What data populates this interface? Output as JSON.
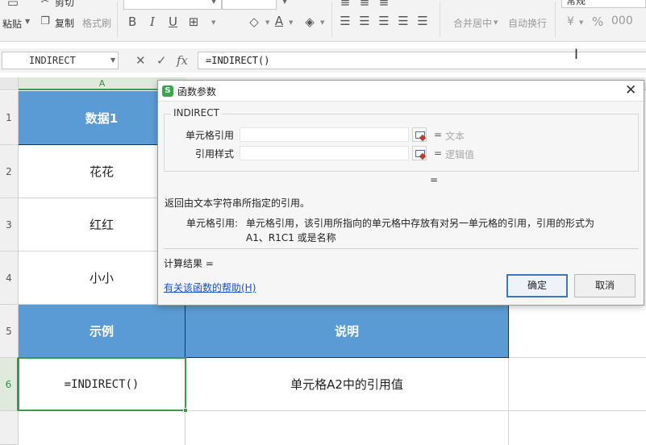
{
  "ribbon": {
    "paste_label": "粘贴",
    "cut_label": "剪切",
    "copy_label": "复制",
    "format_painter_label": "格式刷",
    "bold": "B",
    "italic": "I",
    "underline": "U",
    "merge_center_label": "合并居中",
    "wrap_text_label": "自动换行",
    "number_format_value": "常规",
    "percent_symbol": "%",
    "currency_symbol": "¥"
  },
  "formula_bar": {
    "name_box": "INDIRECT",
    "cancel_icon": "✕",
    "enter_icon": "✓",
    "fx_label": "fx",
    "formula": "=INDIRECT()"
  },
  "grid": {
    "column_headers": [
      "A"
    ],
    "row_headers": [
      "1",
      "2",
      "3",
      "4",
      "5",
      "6"
    ],
    "rows": [
      [
        "数据1"
      ],
      [
        "花花"
      ],
      [
        "红红"
      ],
      [
        "小小"
      ],
      [
        "示例",
        "说明"
      ],
      [
        "=INDIRECT()",
        "单元格A2中的引用值"
      ]
    ],
    "active_cell": "A6"
  },
  "dialog": {
    "title": "函数参数",
    "close_icon": "✕",
    "logo_letter": "S",
    "function_name": "INDIRECT",
    "args": [
      {
        "label": "单元格引用",
        "value": "",
        "equals": "=",
        "hint": "文本"
      },
      {
        "label": "引用样式",
        "value": "",
        "equals": "=",
        "hint": "逻辑值"
      }
    ],
    "result_equals": "=",
    "function_description": "返回由文本字符串所指定的引用。",
    "arg_description_label": "单元格引用:",
    "arg_description_text": "单元格引用，该引用所指向的单元格中存放有对另一单元格的引用，引用的形式为 A1、R1C1 或是名称",
    "calc_result_label": "计算结果 =",
    "help_link": "有关该函数的帮助(H)",
    "ok_label": "确定",
    "cancel_label": "取消"
  }
}
